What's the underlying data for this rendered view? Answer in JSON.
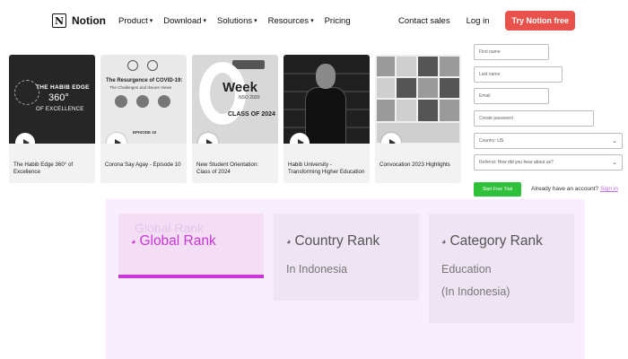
{
  "nav": {
    "logo_text": "Notion",
    "logo_glyph": "N",
    "items": [
      {
        "label": "Product",
        "has_dropdown": true
      },
      {
        "label": "Download",
        "has_dropdown": true
      },
      {
        "label": "Solutions",
        "has_dropdown": true
      },
      {
        "label": "Resources",
        "has_dropdown": true
      },
      {
        "label": "Pricing",
        "has_dropdown": false
      }
    ],
    "contact_sales": "Contact sales",
    "log_in": "Log in",
    "try_free": "Try Notion free"
  },
  "videos": [
    {
      "title": "The Habib Edge 360° of Excellence",
      "thumb_text": [
        "THE HABIB EDGE",
        "360°",
        "OF EXCELLENCE"
      ]
    },
    {
      "title": "Corona Say Agay - Episode 10",
      "thumb_text": [
        "The Resurgence of COVID-19:",
        "The Challenges and Issues Views",
        "EPISODE 10"
      ]
    },
    {
      "title": "New Student Orientation: Class of 2024",
      "thumb_text": [
        "Week",
        "NSO 2020",
        "CLASS OF 2024"
      ]
    },
    {
      "title": "Habib University - Transforming Higher Education",
      "thumb_text": []
    },
    {
      "title": "Convocation 2023 Highlights",
      "thumb_text": []
    }
  ],
  "signup": {
    "first_name_placeholder": "First name",
    "last_name_placeholder": "Last name",
    "email_placeholder": "Email",
    "password_placeholder": "Create password",
    "country_label": "Country:",
    "country_value": "US",
    "referral_label": "Referral:",
    "referral_value": "How did you hear about us?",
    "start_button": "Start Free Trial",
    "have_account": "Already have an account?",
    "sign_in": "Sign in"
  },
  "ranks": {
    "global": {
      "title": "Global Rank",
      "active": true
    },
    "country": {
      "title": "Country Rank",
      "sub": "In Indonesia"
    },
    "category": {
      "title": "Category Rank",
      "sub1": "Education",
      "sub2": "(In Indonesia)"
    }
  },
  "colors": {
    "accent_red": "#e8524a",
    "accent_green": "#2fc13a",
    "accent_purple": "#c837d6",
    "panel_bg": "#f9eefd"
  }
}
